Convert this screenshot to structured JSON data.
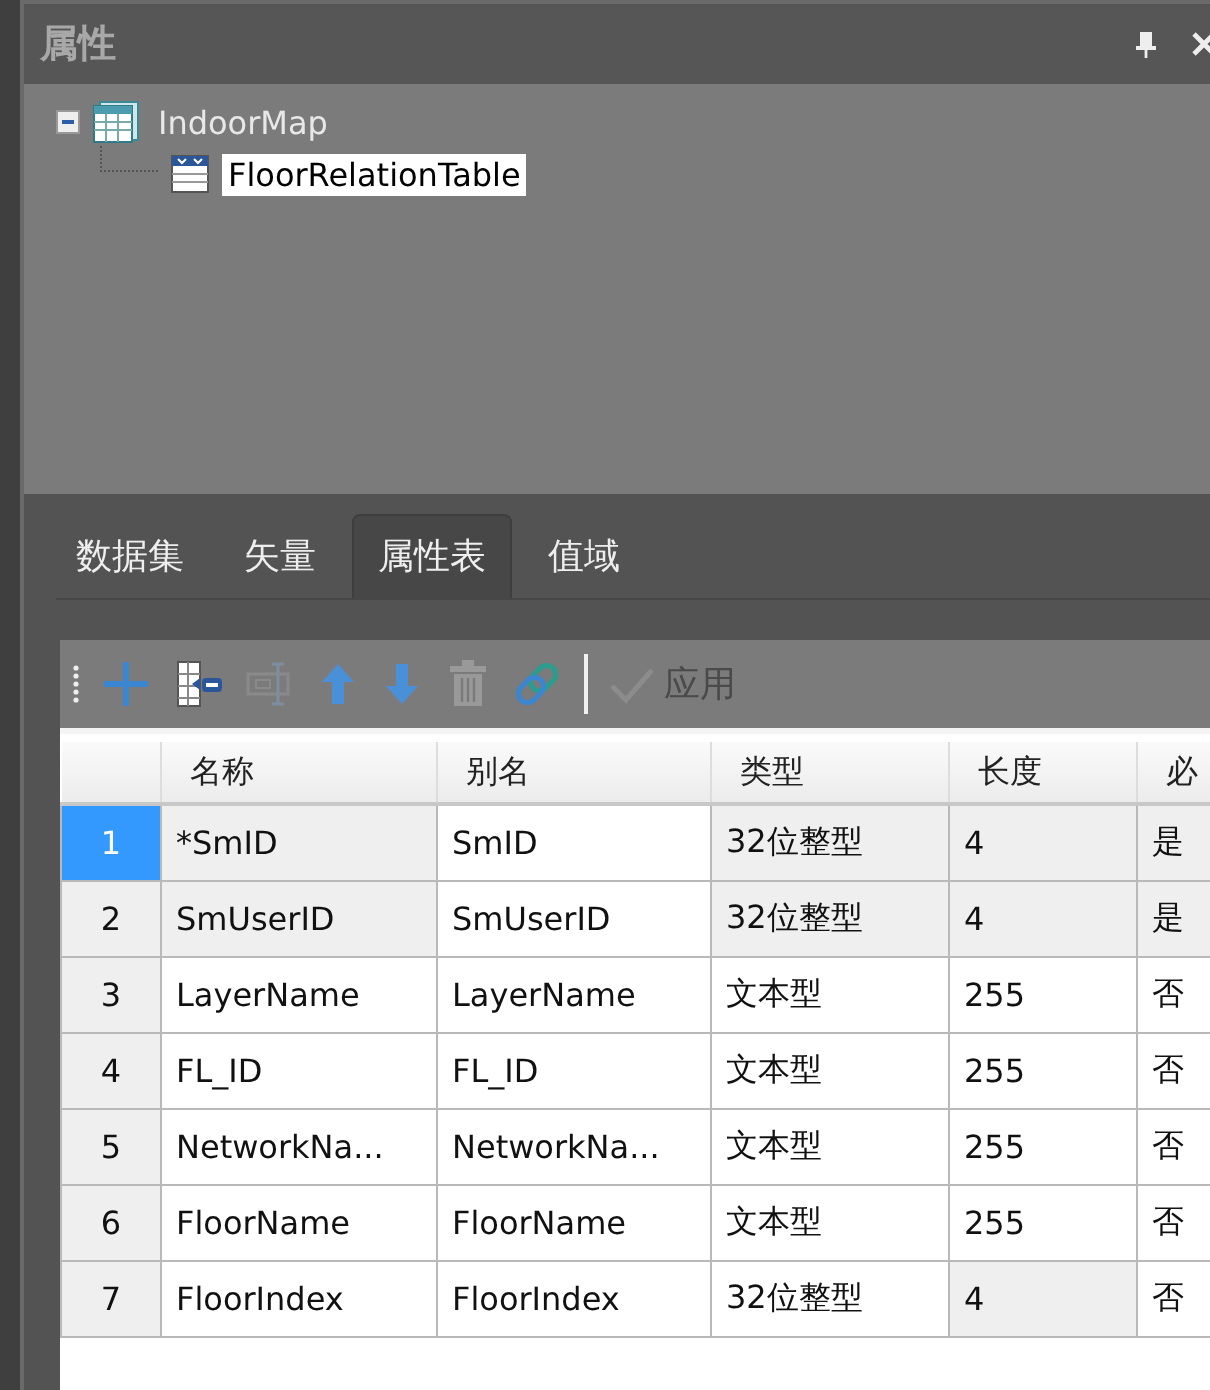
{
  "panel": {
    "title": "属性"
  },
  "tree": [
    {
      "label": "IndoorMap",
      "expanded": true,
      "selected": false,
      "children": [
        {
          "label": "FloorRelationTable",
          "selected": true
        }
      ]
    }
  ],
  "tabs": [
    {
      "label": "数据集",
      "selected": false
    },
    {
      "label": "矢量",
      "selected": false
    },
    {
      "label": "属性表",
      "selected": true
    },
    {
      "label": "值域",
      "selected": false
    }
  ],
  "toolbar": [
    {
      "kind": "add",
      "disabled": false
    },
    {
      "kind": "insert",
      "disabled": false
    },
    {
      "kind": "rename",
      "disabled": true
    },
    {
      "kind": "up",
      "disabled": false
    },
    {
      "kind": "down",
      "disabled": false
    },
    {
      "kind": "delete",
      "disabled": true
    },
    {
      "kind": "link",
      "disabled": false
    },
    {
      "kind": "apply",
      "label": "应用",
      "disabled": true
    }
  ],
  "table": {
    "columns": [
      "名称",
      "别名",
      "类型",
      "长度",
      "必"
    ],
    "rows": [
      {
        "index": "1",
        "selected": true,
        "cells": [
          {
            "text": "*SmID",
            "shaded": true
          },
          {
            "text": "SmID",
            "shaded": false
          },
          {
            "text": "32位整型",
            "shaded": true
          },
          {
            "text": "4",
            "shaded": true
          },
          {
            "text": "是",
            "shaded": true
          }
        ]
      },
      {
        "index": "2",
        "selected": false,
        "cells": [
          {
            "text": "SmUserID",
            "shaded": true
          },
          {
            "text": "SmUserID",
            "shaded": false
          },
          {
            "text": "32位整型",
            "shaded": true
          },
          {
            "text": "4",
            "shaded": true
          },
          {
            "text": "是",
            "shaded": true
          }
        ]
      },
      {
        "index": "3",
        "selected": false,
        "cells": [
          {
            "text": "LayerName",
            "shaded": false
          },
          {
            "text": "LayerName",
            "shaded": false
          },
          {
            "text": "文本型",
            "shaded": false
          },
          {
            "text": "255",
            "shaded": false
          },
          {
            "text": "否",
            "shaded": false
          }
        ]
      },
      {
        "index": "4",
        "selected": false,
        "cells": [
          {
            "text": "FL_ID",
            "shaded": false
          },
          {
            "text": "FL_ID",
            "shaded": false
          },
          {
            "text": "文本型",
            "shaded": false
          },
          {
            "text": "255",
            "shaded": false
          },
          {
            "text": "否",
            "shaded": false
          }
        ]
      },
      {
        "index": "5",
        "selected": false,
        "cells": [
          {
            "text": "NetworkNa...",
            "shaded": false
          },
          {
            "text": "NetworkNa...",
            "shaded": false
          },
          {
            "text": "文本型",
            "shaded": false
          },
          {
            "text": "255",
            "shaded": false
          },
          {
            "text": "否",
            "shaded": false
          }
        ]
      },
      {
        "index": "6",
        "selected": false,
        "cells": [
          {
            "text": "FloorName",
            "shaded": false
          },
          {
            "text": "FloorName",
            "shaded": false
          },
          {
            "text": "文本型",
            "shaded": false
          },
          {
            "text": "255",
            "shaded": false
          },
          {
            "text": "否",
            "shaded": false
          }
        ]
      },
      {
        "index": "7",
        "selected": false,
        "cells": [
          {
            "text": "FloorIndex",
            "shaded": false
          },
          {
            "text": "FloorIndex",
            "shaded": false
          },
          {
            "text": "32位整型",
            "shaded": false
          },
          {
            "text": "4",
            "shaded": true
          },
          {
            "text": "否",
            "shaded": false
          }
        ]
      }
    ]
  }
}
